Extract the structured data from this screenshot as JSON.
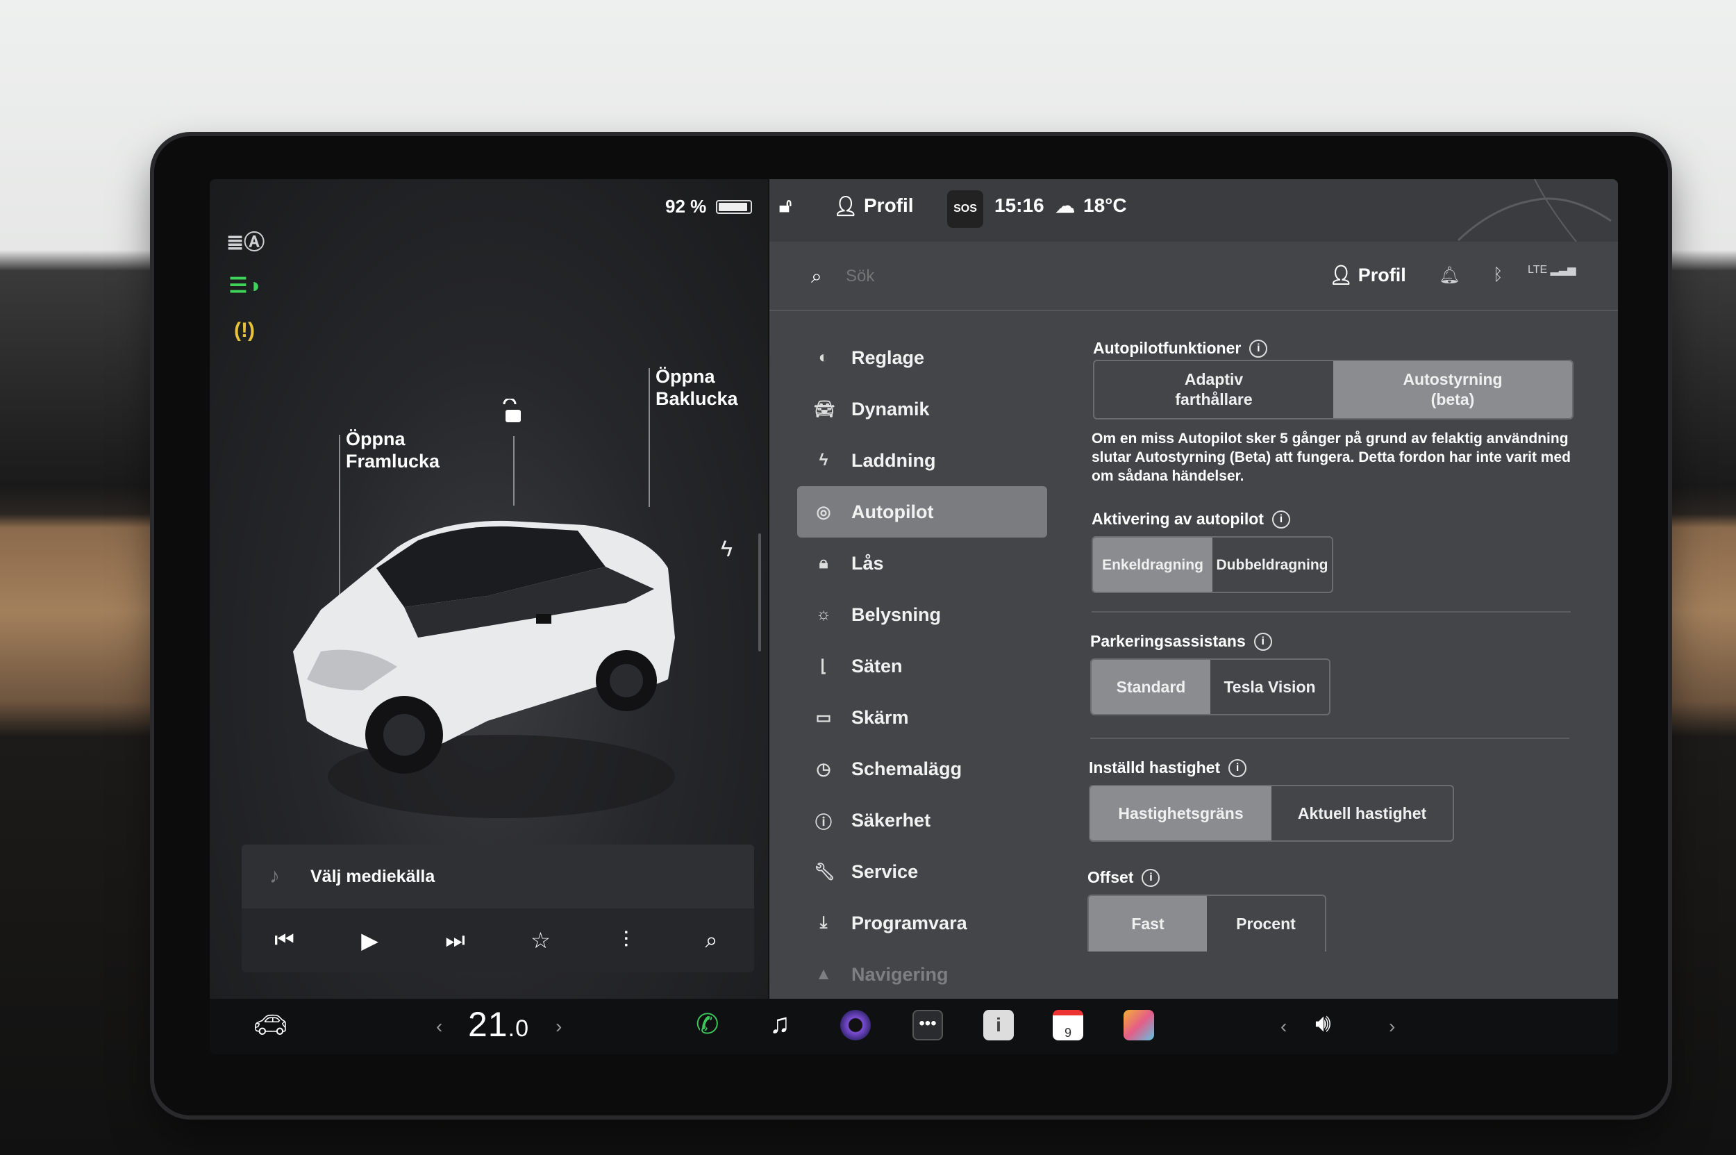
{
  "left": {
    "battery": "92 %",
    "labels": {
      "front": "Öppna\nFramlucka",
      "rear": "Öppna\nBaklucka"
    },
    "media": {
      "source_label": "Välj mediekälla"
    }
  },
  "topbar": {
    "profile": "Profil",
    "sos": "SOS",
    "time": "15:16",
    "temp": "18°C"
  },
  "search": {
    "placeholder": "Sök"
  },
  "header": {
    "profile": "Profil",
    "lte": "LTE"
  },
  "nav": [
    {
      "label": "Reglage",
      "icon": "toggle-icon"
    },
    {
      "label": "Dynamik",
      "icon": "car-icon"
    },
    {
      "label": "Laddning",
      "icon": "bolt-icon"
    },
    {
      "label": "Autopilot",
      "icon": "steering-wheel-icon",
      "active": true
    },
    {
      "label": "Lås",
      "icon": "lock-icon"
    },
    {
      "label": "Belysning",
      "icon": "sun-icon"
    },
    {
      "label": "Säten",
      "icon": "seat-icon"
    },
    {
      "label": "Skärm",
      "icon": "display-icon"
    },
    {
      "label": "Schemalägg",
      "icon": "clock-icon"
    },
    {
      "label": "Säkerhet",
      "icon": "alert-icon"
    },
    {
      "label": "Service",
      "icon": "wrench-icon"
    },
    {
      "label": "Programvara",
      "icon": "download-icon"
    },
    {
      "label": "Navigering",
      "icon": "navigation-icon"
    }
  ],
  "autopilot": {
    "features_title": "Autopilotfunktioner",
    "features_options": [
      "Adaptiv\nfarthållare",
      "Autostyrning\n(beta)"
    ],
    "features_selected": 1,
    "description": "Om en miss Autopilot sker 5 gånger på grund av felaktig användning slutar Autostyrning (Beta) att fungera. Detta fordon har inte varit med om sådana händelser.",
    "activation_title": "Aktivering av autopilot",
    "activation_options": [
      "Enkeldragning",
      "Dubbeldragning"
    ],
    "activation_selected": 0,
    "parking_title": "Parkeringsassistans",
    "parking_options": [
      "Standard",
      "Tesla Vision"
    ],
    "parking_selected": 0,
    "speed_title": "Inställd hastighet",
    "speed_options": [
      "Hastighetsgräns",
      "Aktuell hastighet"
    ],
    "speed_selected": 0,
    "offset_title": "Offset",
    "offset_options": [
      "Fast",
      "Procent"
    ],
    "offset_selected": 0
  },
  "bottom": {
    "temperature": "21",
    "temperature_decimal": ".0",
    "calendar_day": "9"
  },
  "colors": {
    "accent_green": "#3fd35a",
    "warning_yellow": "#e8c33a",
    "phone_green": "#3cc65a"
  }
}
